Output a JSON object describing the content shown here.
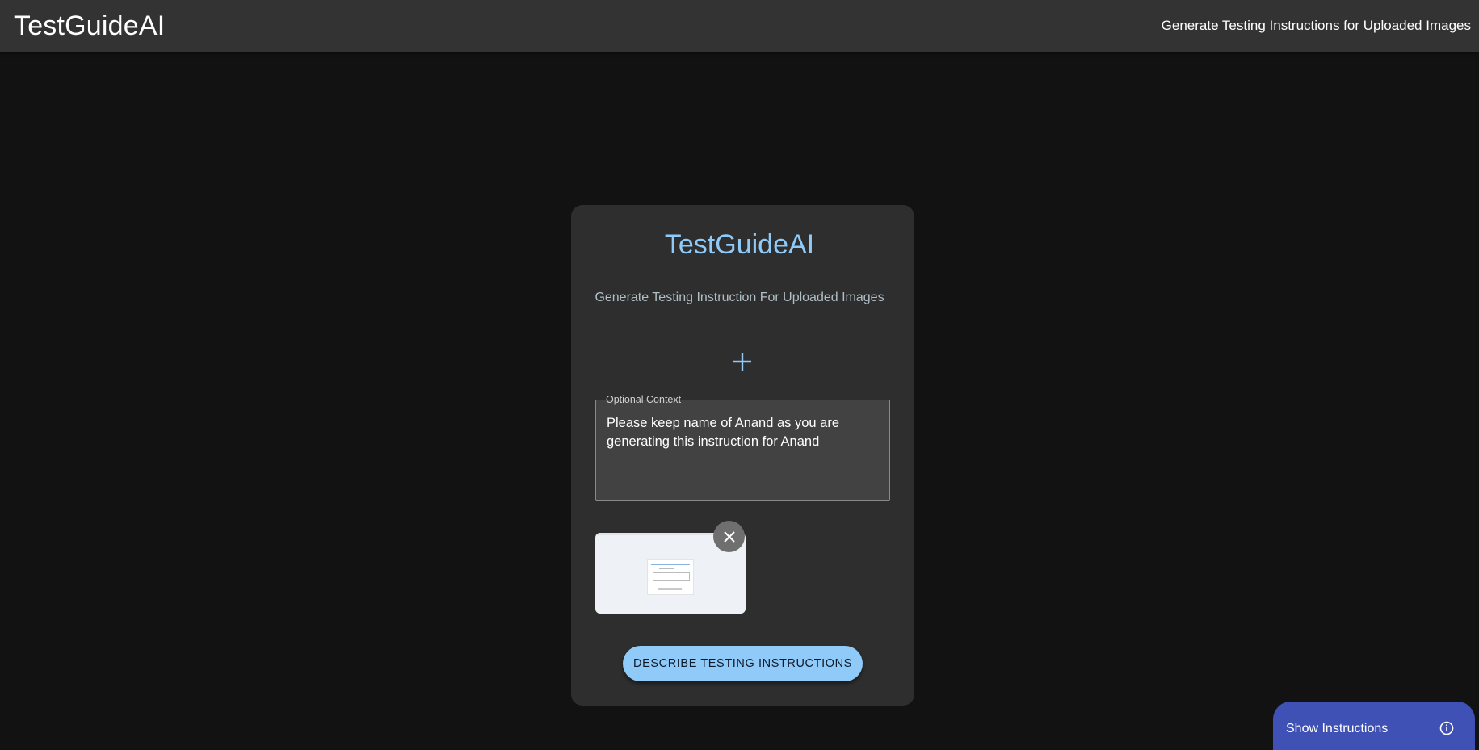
{
  "appbar": {
    "title": "TestGuideAI",
    "subtitle": "Generate Testing Instructions for Uploaded Images"
  },
  "card": {
    "title": "TestGuideAI",
    "subtitle": "Generate Testing Instruction For Uploaded Images",
    "add_icon": "plus-icon",
    "context": {
      "label": "Optional Context",
      "value": "Please keep name of Anand as you are generating this instruction for Anand"
    },
    "thumbnail": {
      "remove_icon": "close-icon"
    },
    "describe_button": "DESCRIBE TESTING INSTRUCTIONS"
  },
  "floating": {
    "label": "Show Instructions",
    "icon": "info-icon"
  },
  "colors": {
    "background": "#121212",
    "appbar": "#333333",
    "card": "#2e2e2e",
    "accent": "#90caf9",
    "floating_button": "#3f51b5"
  }
}
